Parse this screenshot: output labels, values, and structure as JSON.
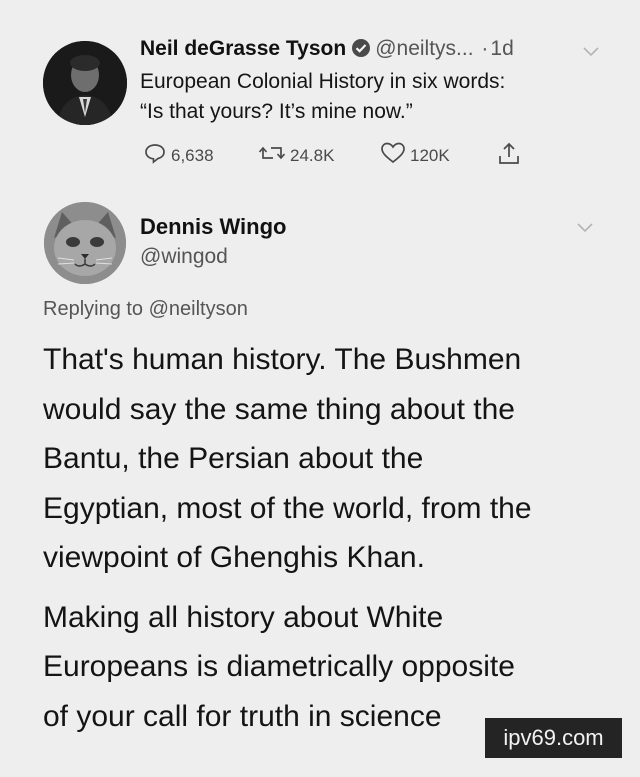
{
  "tweet1": {
    "author_name": "Neil deGrasse Tyson",
    "handle": "@neiltys...",
    "separator": "·",
    "time": "1d",
    "text_line1": "European Colonial History in six words:",
    "text_line2": "“Is that yours? It’s mine now.”",
    "replies": "6,638",
    "retweets": "24.8K",
    "likes": "120K"
  },
  "tweet2": {
    "author_name": "Dennis Wingo",
    "handle": "@wingod",
    "replying_to": "Replying to @neiltyson",
    "paragraph1_lines": [
      "That's human history.  The Bushmen",
      "would say the same thing about the",
      "Bantu, the Persian about the",
      "Egyptian, most of the world, from the",
      "viewpoint of Ghenghis Khan."
    ],
    "paragraph2_lines": [
      "Making all history about White",
      "Europeans is diametrically opposite",
      "of your call for truth in science"
    ]
  },
  "watermark": "ipv69.com",
  "colors": {
    "background": "#eeeeee",
    "text": "#141414",
    "muted": "#555555",
    "watermark_bg": "#242424"
  },
  "icons": [
    "verified-badge-icon",
    "chevron-down-icon",
    "reply-icon",
    "retweet-icon",
    "like-icon",
    "share-icon"
  ]
}
